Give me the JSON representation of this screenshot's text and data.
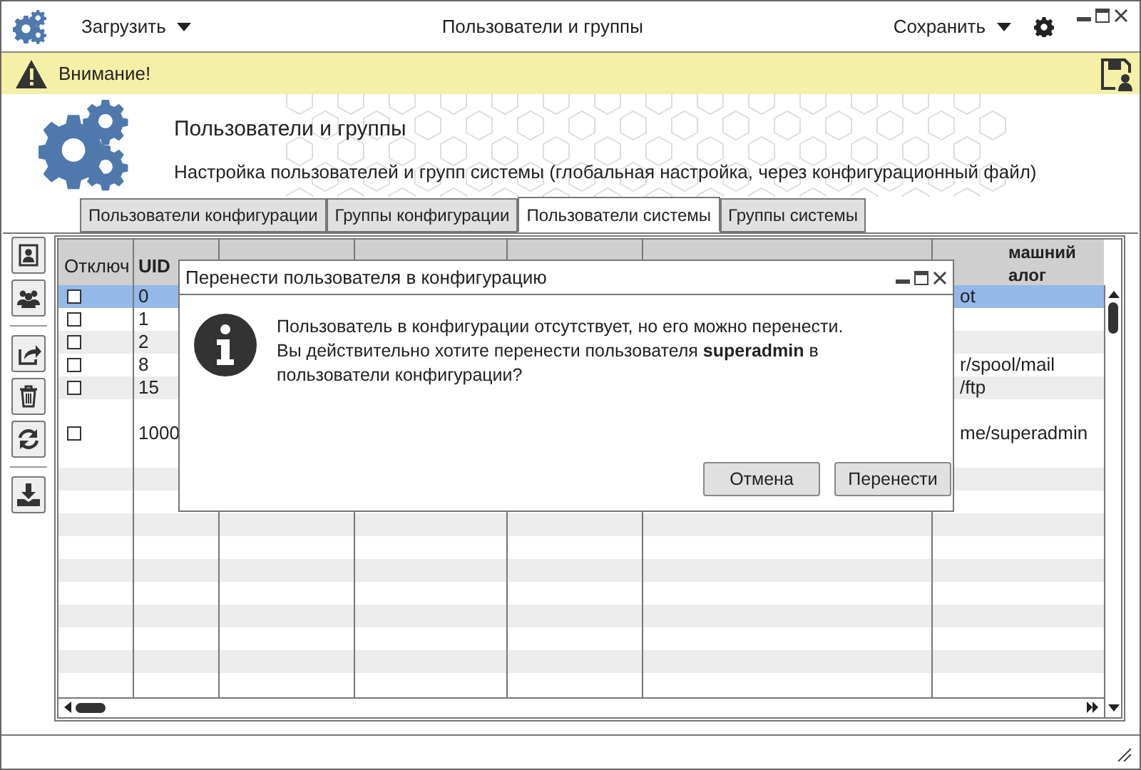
{
  "window": {
    "title": "Пользователи и группы",
    "load_menu": "Загрузить",
    "save_menu": "Сохранить"
  },
  "warning": {
    "text": "Внимание!"
  },
  "header": {
    "title": "Пользователи и группы",
    "subtitle": "Настройка пользователей и групп системы (глобальная настройка, через конфигурационный файл)"
  },
  "tabs": [
    {
      "label": "Пользователи конфигурации",
      "selected": false
    },
    {
      "label": "Группы конфигурации",
      "selected": false
    },
    {
      "label": "Пользователи системы",
      "selected": true
    },
    {
      "label": "Группы системы",
      "selected": false
    }
  ],
  "table": {
    "columns": [
      "Отключ",
      "UID",
      "машний\nалог"
    ],
    "rows": [
      {
        "checked": false,
        "uid": "0",
        "home": "ot",
        "selected": true
      },
      {
        "checked": false,
        "uid": "1",
        "home": "",
        "selected": false
      },
      {
        "checked": false,
        "uid": "2",
        "home": "",
        "selected": false
      },
      {
        "checked": false,
        "uid": "8",
        "home": "r/spool/mail",
        "selected": false
      },
      {
        "checked": false,
        "uid": "15",
        "home": "/ftp",
        "selected": false
      },
      {
        "checked": false,
        "uid": "1000",
        "home": "me/superadmin",
        "selected": false
      }
    ]
  },
  "dialog": {
    "title": "Перенести пользователя в конфигурацию",
    "lines": [
      "Пользователь в конфигурации отсутствует, но его можно перенести.",
      "Вы действительно хотите перенести пользователя **superadmin** в пользователи конфигурации?"
    ],
    "buttons": [
      "Отмена",
      "Перенести"
    ]
  }
}
